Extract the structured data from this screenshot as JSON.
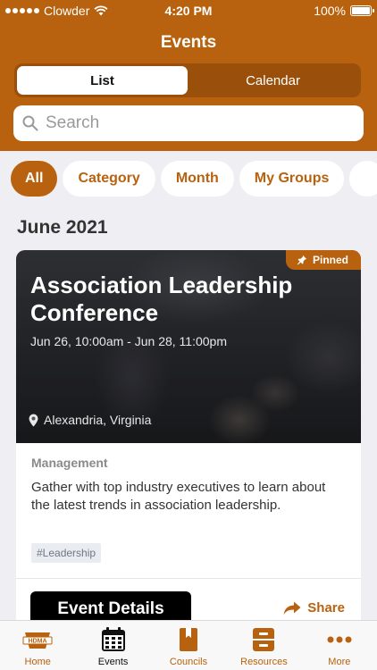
{
  "status_bar": {
    "carrier": "Clowder",
    "time": "4:20 PM",
    "battery": "100%"
  },
  "header": {
    "title": "Events",
    "segments": [
      "List",
      "Calendar"
    ],
    "active_segment": "List"
  },
  "search": {
    "placeholder": "Search"
  },
  "filters": {
    "chips": [
      "All",
      "Category",
      "Month",
      "My Groups"
    ],
    "active": "All"
  },
  "month_heading": "June 2021",
  "event": {
    "pinned_label": "Pinned",
    "title": "Association Leadership Conference",
    "dates": "Jun 26, 10:00am - Jun 28, 11:00pm",
    "location": "Alexandria, Virginia",
    "category": "Management",
    "description": "Gather with top industry executives to learn about the latest trends in association leadership.",
    "tag": "#Leadership",
    "details_button": "Event Details",
    "share_label": "Share"
  },
  "tabbar": {
    "home_logo_text": "HDMA",
    "items": [
      {
        "label": "Home",
        "icon": "hdma-logo-icon"
      },
      {
        "label": "Events",
        "icon": "calendar-icon"
      },
      {
        "label": "Councils",
        "icon": "bookmark-book-icon"
      },
      {
        "label": "Resources",
        "icon": "file-cabinet-icon"
      },
      {
        "label": "More",
        "icon": "ellipsis-icon"
      }
    ],
    "active": "Events"
  },
  "colors": {
    "brand": "#b8620f",
    "background": "#efeef3",
    "button_dark": "#000000"
  }
}
